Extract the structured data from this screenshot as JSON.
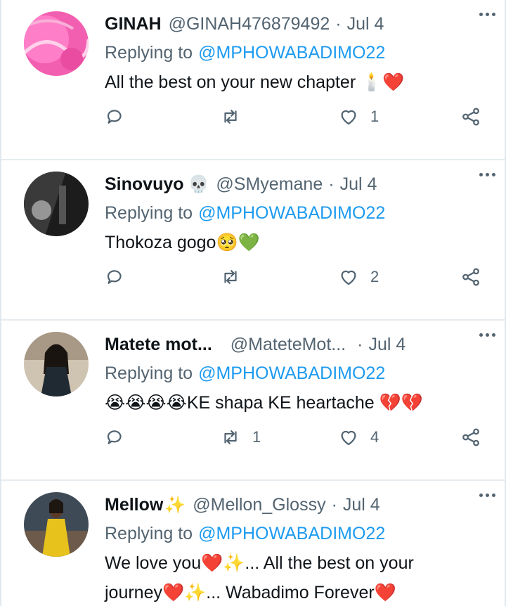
{
  "tweets": [
    {
      "name": "GINAH",
      "name_emoji": "",
      "handle": "@GINAH476879492",
      "separator": "·",
      "date": "Jul 4",
      "replying_label": "Replying to",
      "replying_to": "@MPHOWABADIMO22",
      "text": "All the best on your new chapter",
      "text_emojis": "🕯️❤️",
      "replies": "",
      "retweets": "",
      "likes": "1",
      "avatar_icon": "pink-abstract-avatar"
    },
    {
      "name": "Sinovuyo",
      "name_emoji": "💀",
      "handle": "@SMyemane",
      "separator": "·",
      "date": "Jul 4",
      "replying_label": "Replying to",
      "replying_to": "@MPHOWABADIMO22",
      "text": "Thokoza gogo",
      "text_emojis": "🥺💚",
      "replies": "",
      "retweets": "",
      "likes": "2",
      "avatar_icon": "dark-monochrome-avatar"
    },
    {
      "name": "Matete mot...",
      "name_emoji": "",
      "handle": "@MateteMot...",
      "separator": "·",
      "date": "Jul 4",
      "replying_label": "Replying to",
      "replying_to": "@MPHOWABADIMO22",
      "text_prefix_emojis": "😭😭😭😭",
      "text": "KE shapa KE heartache",
      "text_emojis": "💔💔",
      "replies": "",
      "retweets": "1",
      "likes": "4",
      "avatar_icon": "woman-portrait-avatar"
    },
    {
      "name": "Mellow",
      "name_emoji": "✨",
      "handle": "@Mellon_Glossy",
      "separator": "·",
      "date": "Jul 4",
      "replying_label": "Replying to",
      "replying_to": "@MPHOWABADIMO22",
      "line1_a": "We love you",
      "line1_emojis": "❤️✨",
      "line1_b": "... All the best on your",
      "line2_a": "journey",
      "line2_emojis": "❤️✨",
      "line2_b": "... Wabadimo Forever",
      "line2_end_emoji": "❤️",
      "avatar_icon": "woman-yellow-dress-avatar"
    }
  ],
  "colors": {
    "link": "#1d9bf0",
    "secondary_text": "#536471",
    "primary_text": "#0f1419",
    "divider": "#e6ecf0"
  },
  "icons": [
    "reply-icon",
    "retweet-icon",
    "like-icon",
    "share-icon",
    "more-icon"
  ]
}
